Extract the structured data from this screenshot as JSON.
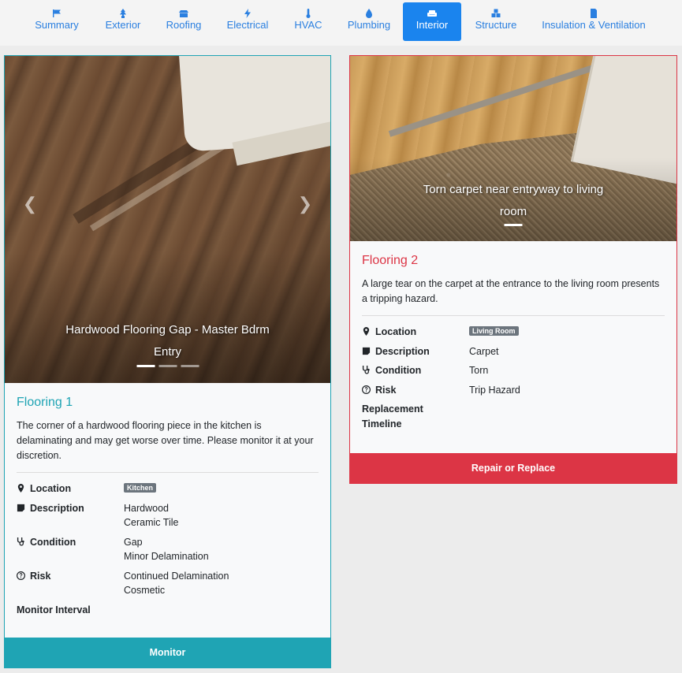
{
  "nav": {
    "tabs": [
      {
        "label": "Summary",
        "icon": "flag-icon"
      },
      {
        "label": "Exterior",
        "icon": "tree-icon"
      },
      {
        "label": "Roofing",
        "icon": "roof-icon"
      },
      {
        "label": "Electrical",
        "icon": "bolt-icon"
      },
      {
        "label": "HVAC",
        "icon": "thermometer-icon"
      },
      {
        "label": "Plumbing",
        "icon": "water-drop-icon"
      },
      {
        "label": "Interior",
        "icon": "couch-icon",
        "active": true
      },
      {
        "label": "Structure",
        "icon": "cubes-icon"
      },
      {
        "label": "Insulation & Ventilation",
        "icon": "document-icon"
      }
    ],
    "accent": "#1a84ee"
  },
  "cards": [
    {
      "title": "Flooring 1",
      "accent": "#1fa4b4",
      "photo_caption": "Hardwood Flooring Gap - Master Bdrm Entry",
      "slide_count": 3,
      "active_slide": 1,
      "description": "The corner of a hardwood flooring piece in the kitchen is delaminating and may get worse over time. Please monitor it at your discretion.",
      "details": {
        "location_label": "Location",
        "location_badge": "Kitchen",
        "description_label": "Description",
        "description_values": [
          "Hardwood",
          "Ceramic Tile"
        ],
        "condition_label": "Condition",
        "condition_values": [
          "Gap",
          "Minor Delamination"
        ],
        "risk_label": "Risk",
        "risk_values": [
          "Continued Delamination",
          "Cosmetic"
        ],
        "timeline_label": "Monitor Interval"
      },
      "action_label": "Monitor"
    },
    {
      "title": "Flooring 2",
      "accent": "#dc3545",
      "photo_caption": "Torn carpet near entryway to living room",
      "slide_count": 1,
      "active_slide": 1,
      "description": "A large tear on the carpet at the entrance to the living room presents a tripping hazard.",
      "details": {
        "location_label": "Location",
        "location_badge": "Living Room",
        "description_label": "Description",
        "description_values": [
          "Carpet"
        ],
        "condition_label": "Condition",
        "condition_values": [
          "Torn"
        ],
        "risk_label": "Risk",
        "risk_values": [
          "Trip Hazard"
        ],
        "timeline_label": "Replacement Timeline"
      },
      "action_label": "Repair or Replace"
    }
  ]
}
